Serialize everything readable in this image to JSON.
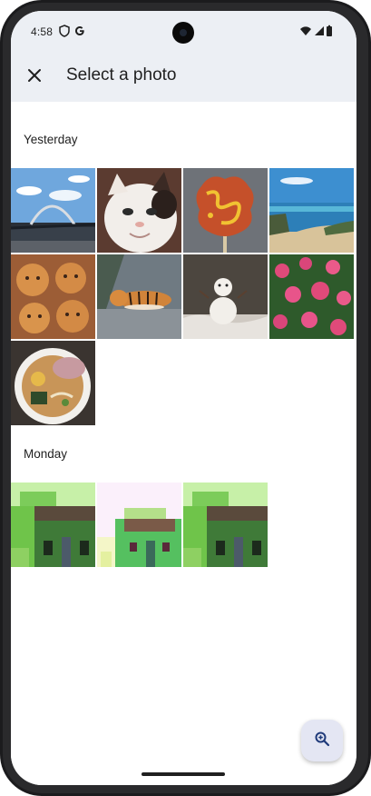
{
  "status_bar": {
    "time": "4:58",
    "icons": [
      "shield-icon",
      "google-g-icon",
      "wifi-icon",
      "signal-icon",
      "battery-icon"
    ]
  },
  "app_bar": {
    "title": "Select a photo",
    "close_icon": "close-icon"
  },
  "sections": [
    {
      "label": "Yesterday",
      "photos": [
        {
          "subject": "bridge-arch"
        },
        {
          "subject": "white-cat"
        },
        {
          "subject": "fried-food-on-stick"
        },
        {
          "subject": "beach-coast"
        },
        {
          "subject": "animal-buns"
        },
        {
          "subject": "tiger"
        },
        {
          "subject": "snowman"
        },
        {
          "subject": "pink-roses"
        },
        {
          "subject": "ramen-bowl"
        }
      ]
    },
    {
      "label": "Monday",
      "photos": [
        {
          "subject": "pixel-house-green"
        },
        {
          "subject": "pixel-house-pink"
        },
        {
          "subject": "pixel-house-green-2"
        }
      ]
    }
  ],
  "fab": {
    "icon": "zoom-in-icon"
  },
  "colors": {
    "app_bar_bg": "#eceff4",
    "fab_bg": "#e4e6f3",
    "fab_icon": "#1f3a7a"
  }
}
